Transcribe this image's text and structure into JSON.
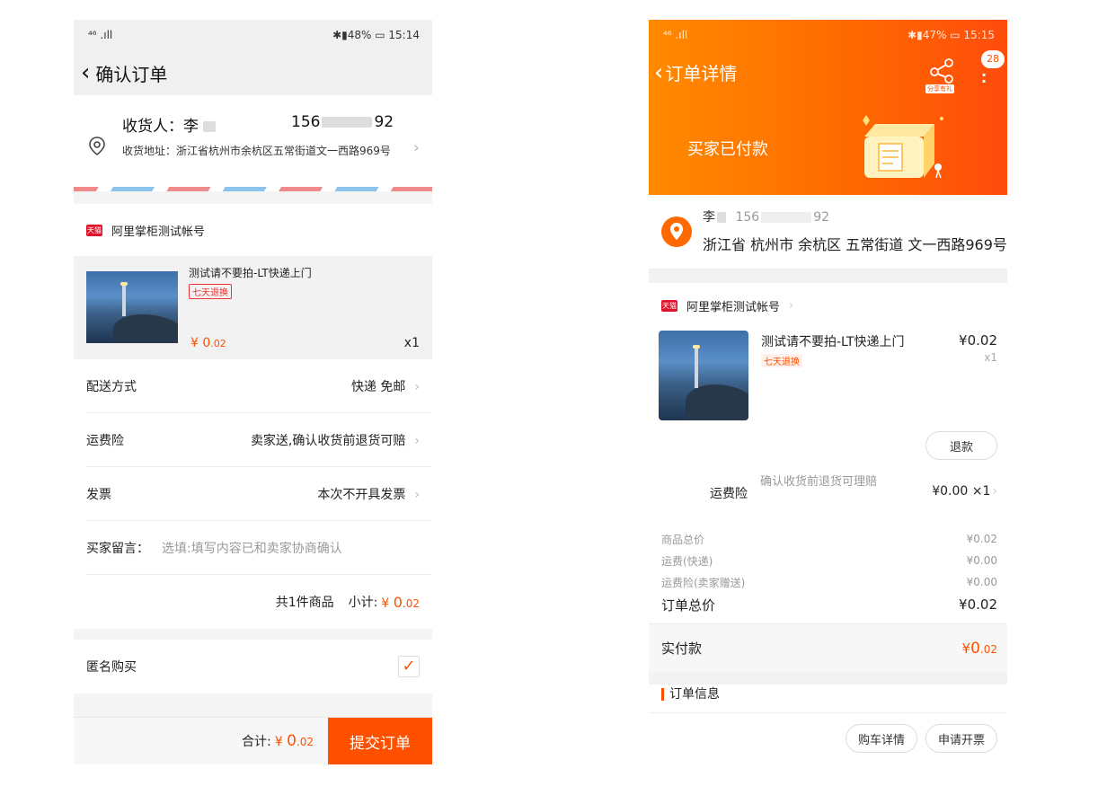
{
  "left": {
    "status": {
      "signal": "⁴⁶ .ıll",
      "right": "✱▮48% ▭ 15:14"
    },
    "nav": {
      "title": "确认订单"
    },
    "address": {
      "recipient_label": "收货人：李",
      "phone_prefix": "156",
      "phone_suffix": "92",
      "address_text": "收货地址：浙江省杭州市余杭区五常街道文一西路969号"
    },
    "shop": {
      "badge": "天猫",
      "name": "阿里掌柜测试帐号"
    },
    "item": {
      "title": "测试请不要拍-LT快递上门",
      "tag": "七天退换",
      "price_symbol": "¥",
      "price_int": "0",
      "price_dec": ".02",
      "qty": "x1"
    },
    "rows": [
      {
        "label": "配送方式",
        "value": "快递 免邮"
      },
      {
        "label": "运费险",
        "value": "卖家送,确认收货前退货可赔"
      },
      {
        "label": "发票",
        "value": "本次不开具发票"
      }
    ],
    "message": {
      "label": "买家留言：",
      "placeholder": "选填:填写内容已和卖家协商确认"
    },
    "subtotal": {
      "count_text": "共1件商品",
      "label": "小计:",
      "symbol": "¥",
      "int": "0",
      "dec": ".02"
    },
    "anonymous": {
      "label": "匿名购买",
      "checked": true
    },
    "bottom": {
      "total_label": "合计:",
      "symbol": "¥",
      "int": "0",
      "dec": ".02",
      "submit": "提交订单"
    }
  },
  "right": {
    "status": {
      "signal": "⁴⁶ .ıll",
      "right": "✱▮47% ▭ 15:15"
    },
    "nav": {
      "title": "订单详情",
      "share_label": "分享有礼",
      "badge": "28"
    },
    "status_text": "买家已付款",
    "address": {
      "name": "李",
      "phone_prefix": "156",
      "phone_suffix": "92",
      "full": "浙江省 杭州市 余杭区 五常街道 文一西路969号"
    },
    "shop": {
      "badge": "天猫",
      "name": "阿里掌柜测试帐号"
    },
    "item": {
      "title": "测试请不要拍-LT快递上门",
      "tag": "七天退换",
      "price": "¥0.02",
      "qty": "x1"
    },
    "refund": "退款",
    "insurance": {
      "label": "运费险",
      "desc": "确认收货前退货可理赔",
      "value": "¥0.00 ×1"
    },
    "fees": [
      {
        "label": "商品总价",
        "value": "¥0.02"
      },
      {
        "label": "运费(快递)",
        "value": "¥0.00"
      },
      {
        "label": "运费险(卖家赠送)",
        "value": "¥0.00"
      }
    ],
    "order_total": {
      "label": "订单总价",
      "value": "¥0.02"
    },
    "paid": {
      "label": "实付款",
      "symbol": "¥",
      "int": "0",
      "dec": ".02"
    },
    "info_title": "订单信息",
    "footer": {
      "cart": "购车详情",
      "invoice": "申请开票"
    }
  },
  "colors": {
    "accent": "#ff5000",
    "header_start": "#ff8a00",
    "header_end": "#ff4c0c"
  }
}
